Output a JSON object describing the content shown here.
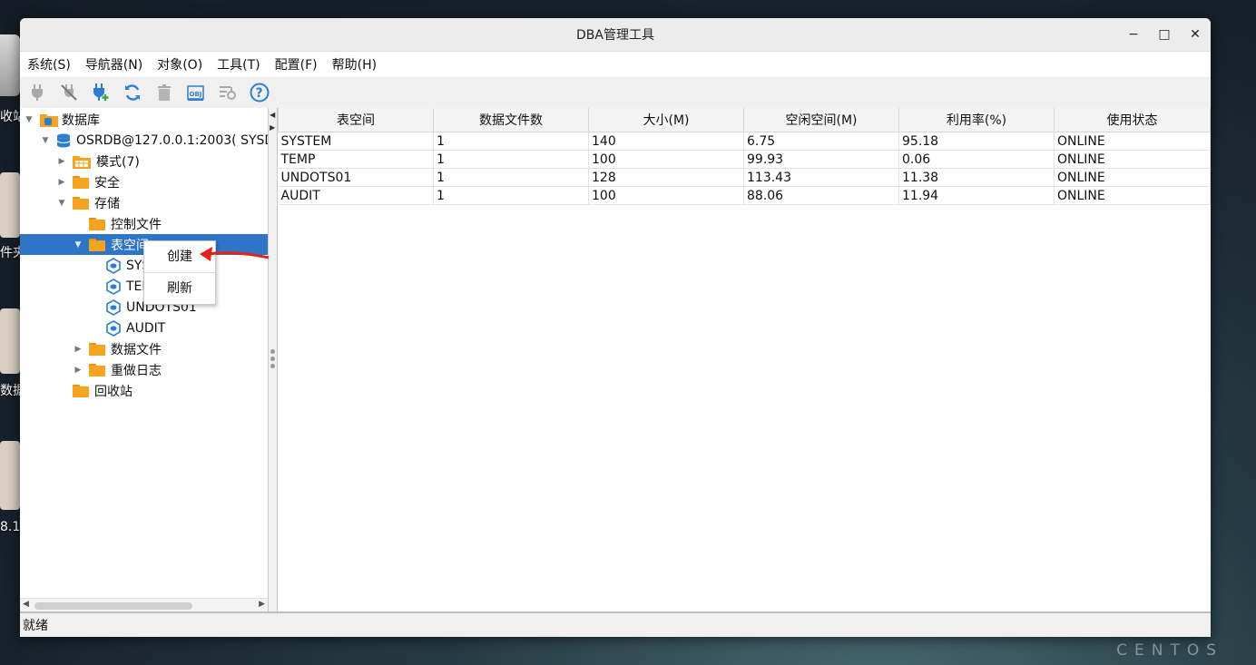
{
  "window": {
    "title": "DBA管理工具",
    "minimize": "−",
    "maximize": "□",
    "close": "✕"
  },
  "menu": [
    "系统(S)",
    "导航器(N)",
    "对象(O)",
    "工具(T)",
    "配置(F)",
    "帮助(H)"
  ],
  "toolbar": [
    {
      "name": "connect-icon",
      "color": "#a9a9a9"
    },
    {
      "name": "disconnect-icon",
      "color": "#a9a9a9"
    },
    {
      "name": "new-connection-icon",
      "color": "#2a7fd4"
    },
    {
      "name": "refresh-icon",
      "color": "#2a7fd4"
    },
    {
      "name": "delete-icon",
      "color": "#a9a9a9"
    },
    {
      "name": "obj-icon",
      "color": "#2a7fd4"
    },
    {
      "name": "settings-icon",
      "color": "#a9a9a9"
    },
    {
      "name": "help-icon",
      "color": "#2a7fd4"
    }
  ],
  "tree": {
    "root": "数据库",
    "connection": "OSRDB@127.0.0.1:2003( SYSD",
    "schemas": "模式(7)",
    "security": "安全",
    "storage": "存储",
    "control_files": "控制文件",
    "tablespaces": "表空间",
    "ts_items": [
      "SYSTEM",
      "TEMP",
      "UNDOTS01",
      "AUDIT"
    ],
    "data_files": "数据文件",
    "redo_logs": "重做日志",
    "recycle_bin": "回收站"
  },
  "context_menu": {
    "create": "创建",
    "refresh": "刷新"
  },
  "table": {
    "headers": [
      "表空间",
      "数据文件数",
      "大小(M)",
      "空闲空间(M)",
      "利用率(%)",
      "使用状态"
    ],
    "rows": [
      [
        "SYSTEM",
        "1",
        "140",
        "6.75",
        "95.18",
        "ONLINE"
      ],
      [
        "TEMP",
        "1",
        "100",
        "99.93",
        "0.06",
        "ONLINE"
      ],
      [
        "UNDOTS01",
        "1",
        "128",
        "113.43",
        "11.38",
        "ONLINE"
      ],
      [
        "AUDIT",
        "1",
        "100",
        "88.06",
        "11.94",
        "ONLINE"
      ]
    ]
  },
  "status": "就绪",
  "desktop": {
    "labels": [
      "收站",
      "件夹",
      "数据",
      "8.1"
    ],
    "brand": "CENTOS"
  },
  "colors": {
    "selection": "#2e74c7",
    "folder": "#f6a31f",
    "accent": "#2a7fd4",
    "arrow": "#e8201a"
  }
}
